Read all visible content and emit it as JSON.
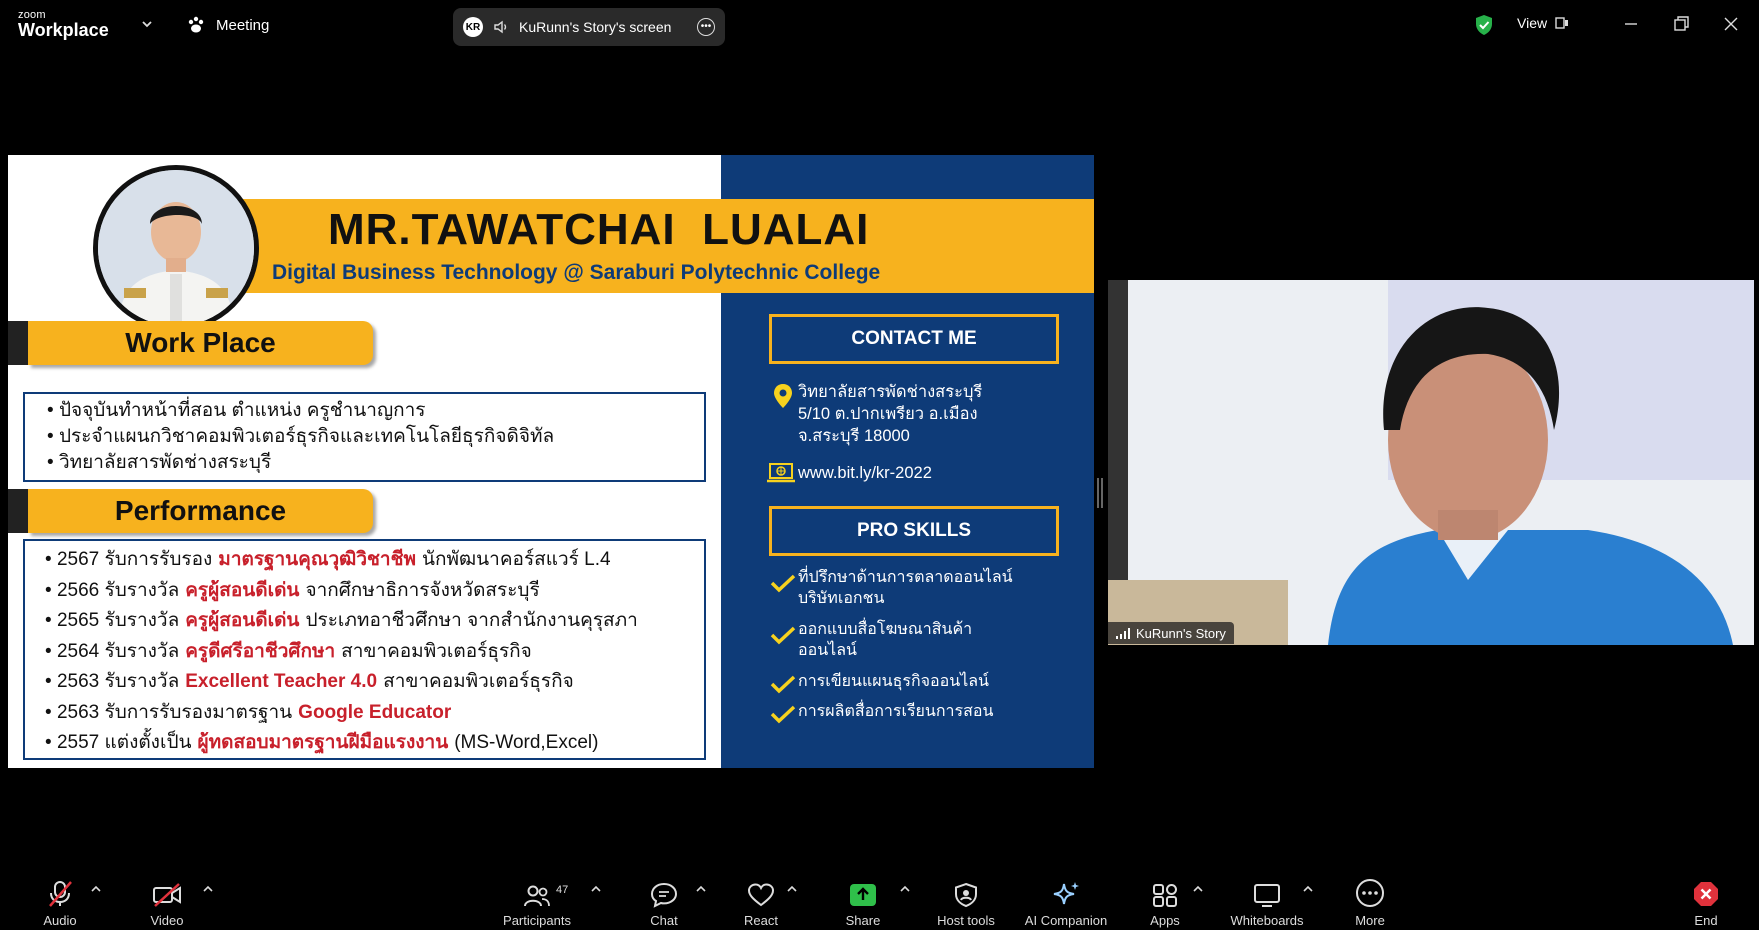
{
  "app": {
    "logo_small": "zoom",
    "logo_big": "Workplace",
    "meeting_label": "Meeting",
    "share_label": "KuRunn's Story's screen",
    "share_avatar": "KR",
    "view_label": "View"
  },
  "slide": {
    "name": "MR.TAWATCHAI  LUALAI",
    "subtitle": "Digital Business Technology @ Saraburi Polytechnic College",
    "work_title": "Work Place",
    "work_items": [
      "ปัจจุบันทำหน้าที่สอน ตำแหน่ง ครูชำนาญการ",
      "ประจำแผนกวิชาคอมพิวเตอร์ธุรกิจและเทคโนโลยีธุรกิจดิจิทัล",
      "วิทยาลัยสารพัดช่างสระบุรี"
    ],
    "perf_title": "Performance",
    "perf_items": [
      {
        "pre": "2567 รับการรับรอง",
        "hl": "มาตรฐานคุณวุฒิวิชาชีพ",
        "post": "นักพัฒนาคอร์สแวร์ L.4"
      },
      {
        "pre": "2566 รับรางวัล",
        "hl": "ครูผู้สอนดีเด่น",
        "post": "จากศึกษาธิการจังหวัดสระบุรี"
      },
      {
        "pre": "2565 รับรางวัล",
        "hl": "ครูผู้สอนดีเด่น",
        "post": "ประเภทอาชีวศึกษา จากสำนักงานคุรุสภา"
      },
      {
        "pre": "2564 รับรางวัล",
        "hl": "ครูดีศรีอาชีวศึกษา",
        "post": "สาขาคอมพิวเตอร์ธุรกิจ"
      },
      {
        "pre": "2563 รับรางวัล",
        "hl": "Excellent Teacher 4.0",
        "post": "สาขาคอมพิวเตอร์ธุรกิจ"
      },
      {
        "pre": "2563 รับการรับรองมาตรฐาน",
        "hl": "Google Educator",
        "post": ""
      },
      {
        "pre": "2557 แต่งตั้งเป็น",
        "hl": "ผู้ทดสอบมาตรฐานฝีมือแรงงาน",
        "post": "(MS-Word,Excel)"
      }
    ],
    "contact_title": "CONTACT ME",
    "address_line1": "วิทยาลัยสารพัดช่างสระบุรี",
    "address_line2": "5/10 ต.ปากเพรียว อ.เมือง",
    "address_line3": "จ.สระบุรี 18000",
    "website": "www.bit.ly/kr-2022",
    "skills_title": "PRO SKILLS",
    "skills": [
      [
        "ที่ปรึกษาด้านการตลาดออนไลน์",
        "บริษัทเอกชน"
      ],
      [
        "ออกแบบสื่อโฆษณาสินค้า",
        "ออนไลน์"
      ],
      [
        "การเขียนแผนธุรกิจออนไลน์"
      ],
      [
        "การผลิตสื่อการเรียนการสอน"
      ]
    ],
    "colors": {
      "navy": "#0e3b78",
      "gold": "#f7b21e",
      "red": "#c8202b"
    }
  },
  "video": {
    "participant_name": "KuRunn's Story"
  },
  "toolbar": {
    "audio": "Audio",
    "video": "Video",
    "participants": "Participants",
    "participants_count": "47",
    "chat": "Chat",
    "react": "React",
    "share": "Share",
    "host_tools": "Host tools",
    "ai_companion": "AI Companion",
    "apps": "Apps",
    "whiteboards": "Whiteboards",
    "more": "More",
    "end": "End"
  }
}
